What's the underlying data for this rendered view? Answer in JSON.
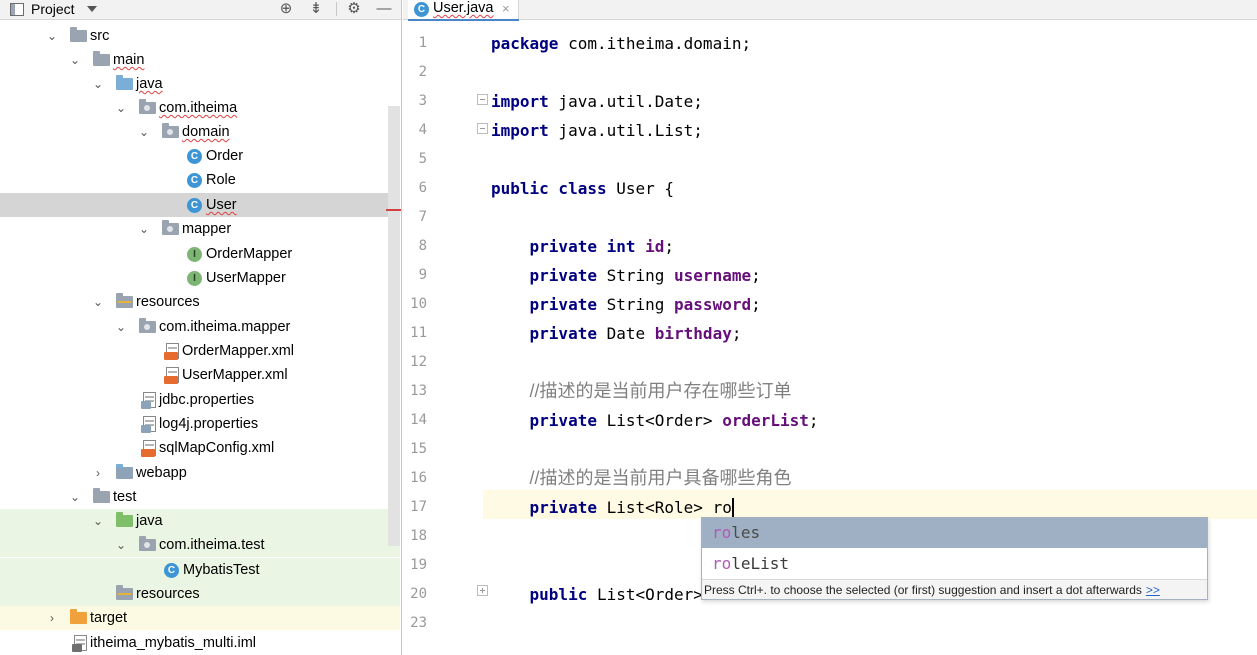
{
  "project_panel": {
    "title": "Project",
    "header_buttons": [
      "crosshair-icon",
      "collapse-all-icon",
      "gear-icon",
      "minimize-icon"
    ],
    "tree": [
      {
        "label": "src",
        "icon": "folder-icon",
        "expanded": true,
        "squiggle": false
      },
      {
        "label": "main",
        "icon": "folder-icon",
        "expanded": true,
        "squiggle": true
      },
      {
        "label": "java",
        "icon": "source-folder-icon",
        "expanded": true,
        "squiggle": true
      },
      {
        "label": "com.itheima",
        "icon": "package-icon",
        "expanded": true,
        "squiggle": true
      },
      {
        "label": "domain",
        "icon": "package-icon",
        "expanded": true,
        "squiggle": true
      },
      {
        "label": "Order",
        "icon": "class-icon",
        "squiggle": false
      },
      {
        "label": "Role",
        "icon": "class-icon",
        "squiggle": false
      },
      {
        "label": "User",
        "icon": "class-icon",
        "squiggle": true,
        "selected": true
      },
      {
        "label": "mapper",
        "icon": "package-icon",
        "expanded": true,
        "squiggle": false
      },
      {
        "label": "OrderMapper",
        "icon": "interface-icon",
        "squiggle": false
      },
      {
        "label": "UserMapper",
        "icon": "interface-icon",
        "squiggle": false
      },
      {
        "label": "resources",
        "icon": "resources-folder-icon",
        "expanded": true,
        "squiggle": false
      },
      {
        "label": "com.itheima.mapper",
        "icon": "package-icon",
        "expanded": true,
        "squiggle": false
      },
      {
        "label": "OrderMapper.xml",
        "icon": "xml-file-icon",
        "squiggle": false
      },
      {
        "label": "UserMapper.xml",
        "icon": "xml-file-icon",
        "squiggle": false
      },
      {
        "label": "jdbc.properties",
        "icon": "properties-file-icon",
        "squiggle": false
      },
      {
        "label": "log4j.properties",
        "icon": "properties-file-icon",
        "squiggle": false
      },
      {
        "label": "sqlMapConfig.xml",
        "icon": "xml-file-icon",
        "squiggle": false
      },
      {
        "label": "webapp",
        "icon": "web-folder-icon",
        "expanded": false,
        "squiggle": false
      },
      {
        "label": "test",
        "icon": "folder-icon",
        "expanded": true,
        "squiggle": false
      },
      {
        "label": "java",
        "icon": "test-source-folder-icon",
        "expanded": true,
        "squiggle": false
      },
      {
        "label": "com.itheima.test",
        "icon": "package-icon",
        "expanded": true,
        "squiggle": false
      },
      {
        "label": "MybatisTest",
        "icon": "class-icon",
        "squiggle": false
      },
      {
        "label": "resources",
        "icon": "test-resources-folder-icon",
        "squiggle": false
      },
      {
        "label": "target",
        "icon": "excluded-folder-icon",
        "expanded": false,
        "squiggle": false
      },
      {
        "label": "itheima_mybatis_multi.iml",
        "icon": "iml-file-icon",
        "squiggle": false
      }
    ]
  },
  "editor": {
    "tab": {
      "label": "User.java",
      "close": "×"
    },
    "code_lines": [
      {
        "num": "1",
        "tokens": [
          {
            "t": "package",
            "c": "kw"
          },
          {
            "t": " com.itheima.domain;",
            "c": ""
          }
        ]
      },
      {
        "num": "2",
        "tokens": []
      },
      {
        "num": "3",
        "tokens": [
          {
            "t": "import",
            "c": "kw"
          },
          {
            "t": " java.util.Date;",
            "c": ""
          }
        ]
      },
      {
        "num": "4",
        "tokens": [
          {
            "t": "import",
            "c": "kw"
          },
          {
            "t": " java.util.List;",
            "c": ""
          }
        ]
      },
      {
        "num": "5",
        "tokens": []
      },
      {
        "num": "6",
        "tokens": [
          {
            "t": "public class",
            "c": "kw"
          },
          {
            "t": " User {",
            "c": ""
          }
        ]
      },
      {
        "num": "7",
        "tokens": []
      },
      {
        "num": "8",
        "tokens": [
          {
            "t": "    ",
            "c": ""
          },
          {
            "t": "private int",
            "c": "kw"
          },
          {
            "t": " ",
            "c": ""
          },
          {
            "t": "id",
            "c": "field"
          },
          {
            "t": ";",
            "c": ""
          }
        ]
      },
      {
        "num": "9",
        "tokens": [
          {
            "t": "    ",
            "c": ""
          },
          {
            "t": "private",
            "c": "kw"
          },
          {
            "t": " String ",
            "c": ""
          },
          {
            "t": "username",
            "c": "field"
          },
          {
            "t": ";",
            "c": ""
          }
        ]
      },
      {
        "num": "10",
        "tokens": [
          {
            "t": "    ",
            "c": ""
          },
          {
            "t": "private",
            "c": "kw"
          },
          {
            "t": " String ",
            "c": ""
          },
          {
            "t": "password",
            "c": "field"
          },
          {
            "t": ";",
            "c": ""
          }
        ]
      },
      {
        "num": "11",
        "tokens": [
          {
            "t": "    ",
            "c": ""
          },
          {
            "t": "private",
            "c": "kw"
          },
          {
            "t": " Date ",
            "c": ""
          },
          {
            "t": "birthday",
            "c": "field"
          },
          {
            "t": ";",
            "c": ""
          }
        ]
      },
      {
        "num": "12",
        "tokens": []
      },
      {
        "num": "13",
        "tokens": [
          {
            "t": "    ",
            "c": ""
          },
          {
            "t": "//描述的是当前用户存在哪些订单",
            "c": "cmt"
          }
        ]
      },
      {
        "num": "14",
        "tokens": [
          {
            "t": "    ",
            "c": ""
          },
          {
            "t": "private",
            "c": "kw"
          },
          {
            "t": " List<Order> ",
            "c": ""
          },
          {
            "t": "orderList",
            "c": "field"
          },
          {
            "t": ";",
            "c": ""
          }
        ]
      },
      {
        "num": "15",
        "tokens": []
      },
      {
        "num": "16",
        "tokens": [
          {
            "t": "    ",
            "c": ""
          },
          {
            "t": "//描述的是当前用户具备哪些角色",
            "c": "cmt"
          }
        ]
      },
      {
        "num": "17",
        "tokens": [
          {
            "t": "    ",
            "c": ""
          },
          {
            "t": "private",
            "c": "kw"
          },
          {
            "t": " List<Role> ro",
            "c": ""
          }
        ],
        "caret": true
      },
      {
        "num": "18",
        "tokens": []
      },
      {
        "num": "19",
        "tokens": []
      },
      {
        "num": "20",
        "tokens": [
          {
            "t": "    ",
            "c": ""
          },
          {
            "t": "public",
            "c": "kw"
          },
          {
            "t": " List<Order>",
            "c": ""
          }
        ]
      },
      {
        "num": "23",
        "tokens": []
      }
    ]
  },
  "completion": {
    "suggestions": [
      {
        "match": "ro",
        "rest": "les",
        "selected": true
      },
      {
        "match": "ro",
        "rest": "leList",
        "selected": false
      }
    ],
    "hint": "Press Ctrl+. to choose the selected (or first) suggestion and insert a dot afterwards",
    "hint_link": ">>"
  }
}
